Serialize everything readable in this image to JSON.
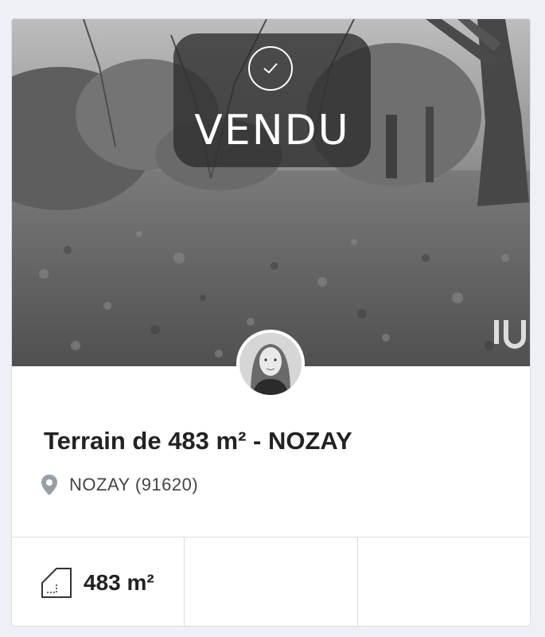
{
  "badge": {
    "status_label": "VENDU",
    "icon": "check-circle-icon"
  },
  "listing": {
    "title": "Terrain de 483 m² - NOZAY",
    "location": "NOZAY (91620)",
    "location_icon": "map-pin-icon"
  },
  "features": [
    {
      "icon": "surface-area-icon",
      "value": "483 m²"
    },
    {
      "value": ""
    },
    {
      "value": ""
    }
  ],
  "colors": {
    "badge_bg": "#2d2d2d",
    "title_text": "#222222",
    "border": "#d9dce3",
    "page_bg": "#eef0f5"
  }
}
